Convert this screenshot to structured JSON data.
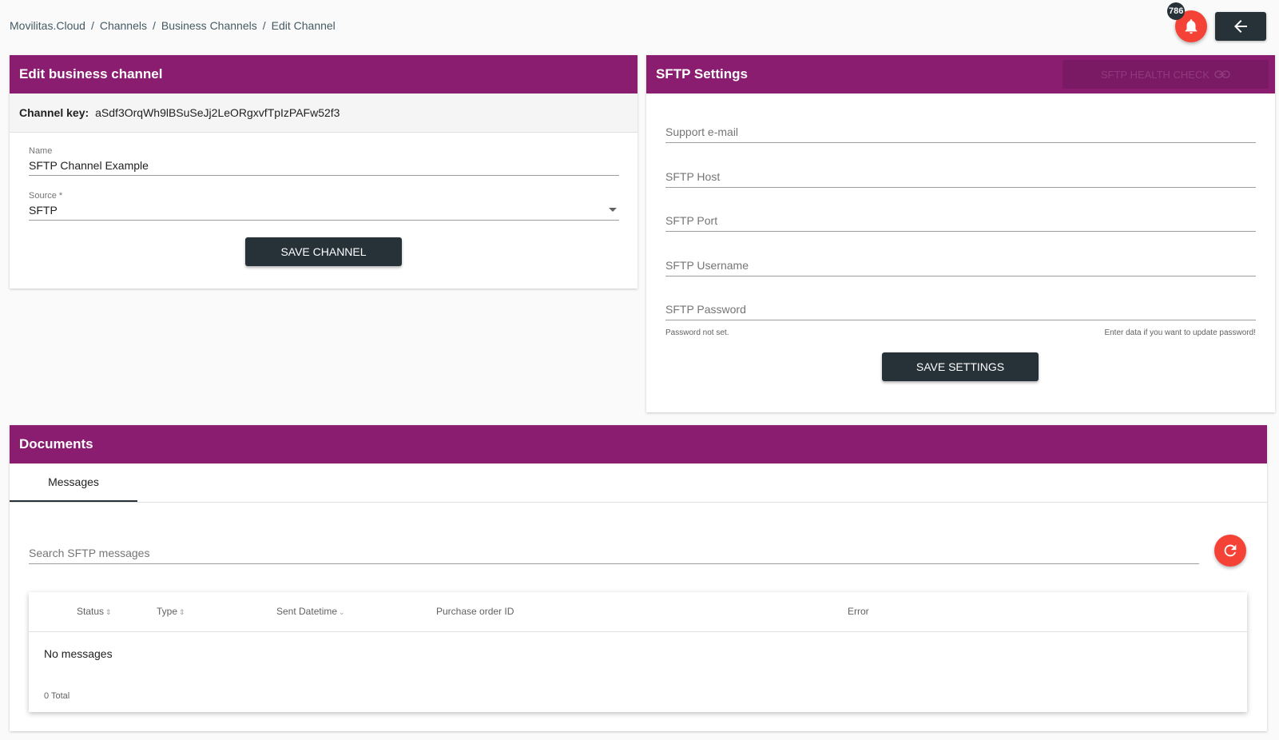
{
  "breadcrumb": [
    "Movilitas.Cloud",
    "Channels",
    "Business Channels",
    "Edit Channel"
  ],
  "header": {
    "notification_count": "786"
  },
  "edit_card": {
    "title": "Edit business channel",
    "channel_key_label": "Channel key:",
    "channel_key_value": "aSdf3OrqWh9lBSuSeJj2LeORgxvfTpIzPAFw52f3",
    "name_label": "Name",
    "name_value": "SFTP Channel Example",
    "source_label": "Source *",
    "source_value": "SFTP",
    "save_label": "SAVE CHANNEL"
  },
  "sftp_card": {
    "title": "SFTP Settings",
    "health_check_label": "SFTP HEALTH CHECK",
    "support_email_placeholder": "Support e-mail",
    "host_placeholder": "SFTP Host",
    "port_placeholder": "SFTP Port",
    "username_placeholder": "SFTP Username",
    "password_placeholder": "SFTP Password",
    "password_hint_left": "Password not set.",
    "password_hint_right": "Enter data if you want to update password!",
    "save_label": "SAVE SETTINGS"
  },
  "documents": {
    "title": "Documents",
    "tabs": [
      "Messages"
    ],
    "search_placeholder": "Search SFTP messages",
    "columns": [
      "Status",
      "Type",
      "Sent Datetime",
      "Purchase order ID",
      "Error"
    ],
    "empty_text": "No messages",
    "total_text": "0 Total"
  },
  "colors": {
    "header": "#8b1d71",
    "dark_button": "#263238",
    "accent_red": "#f44336"
  }
}
